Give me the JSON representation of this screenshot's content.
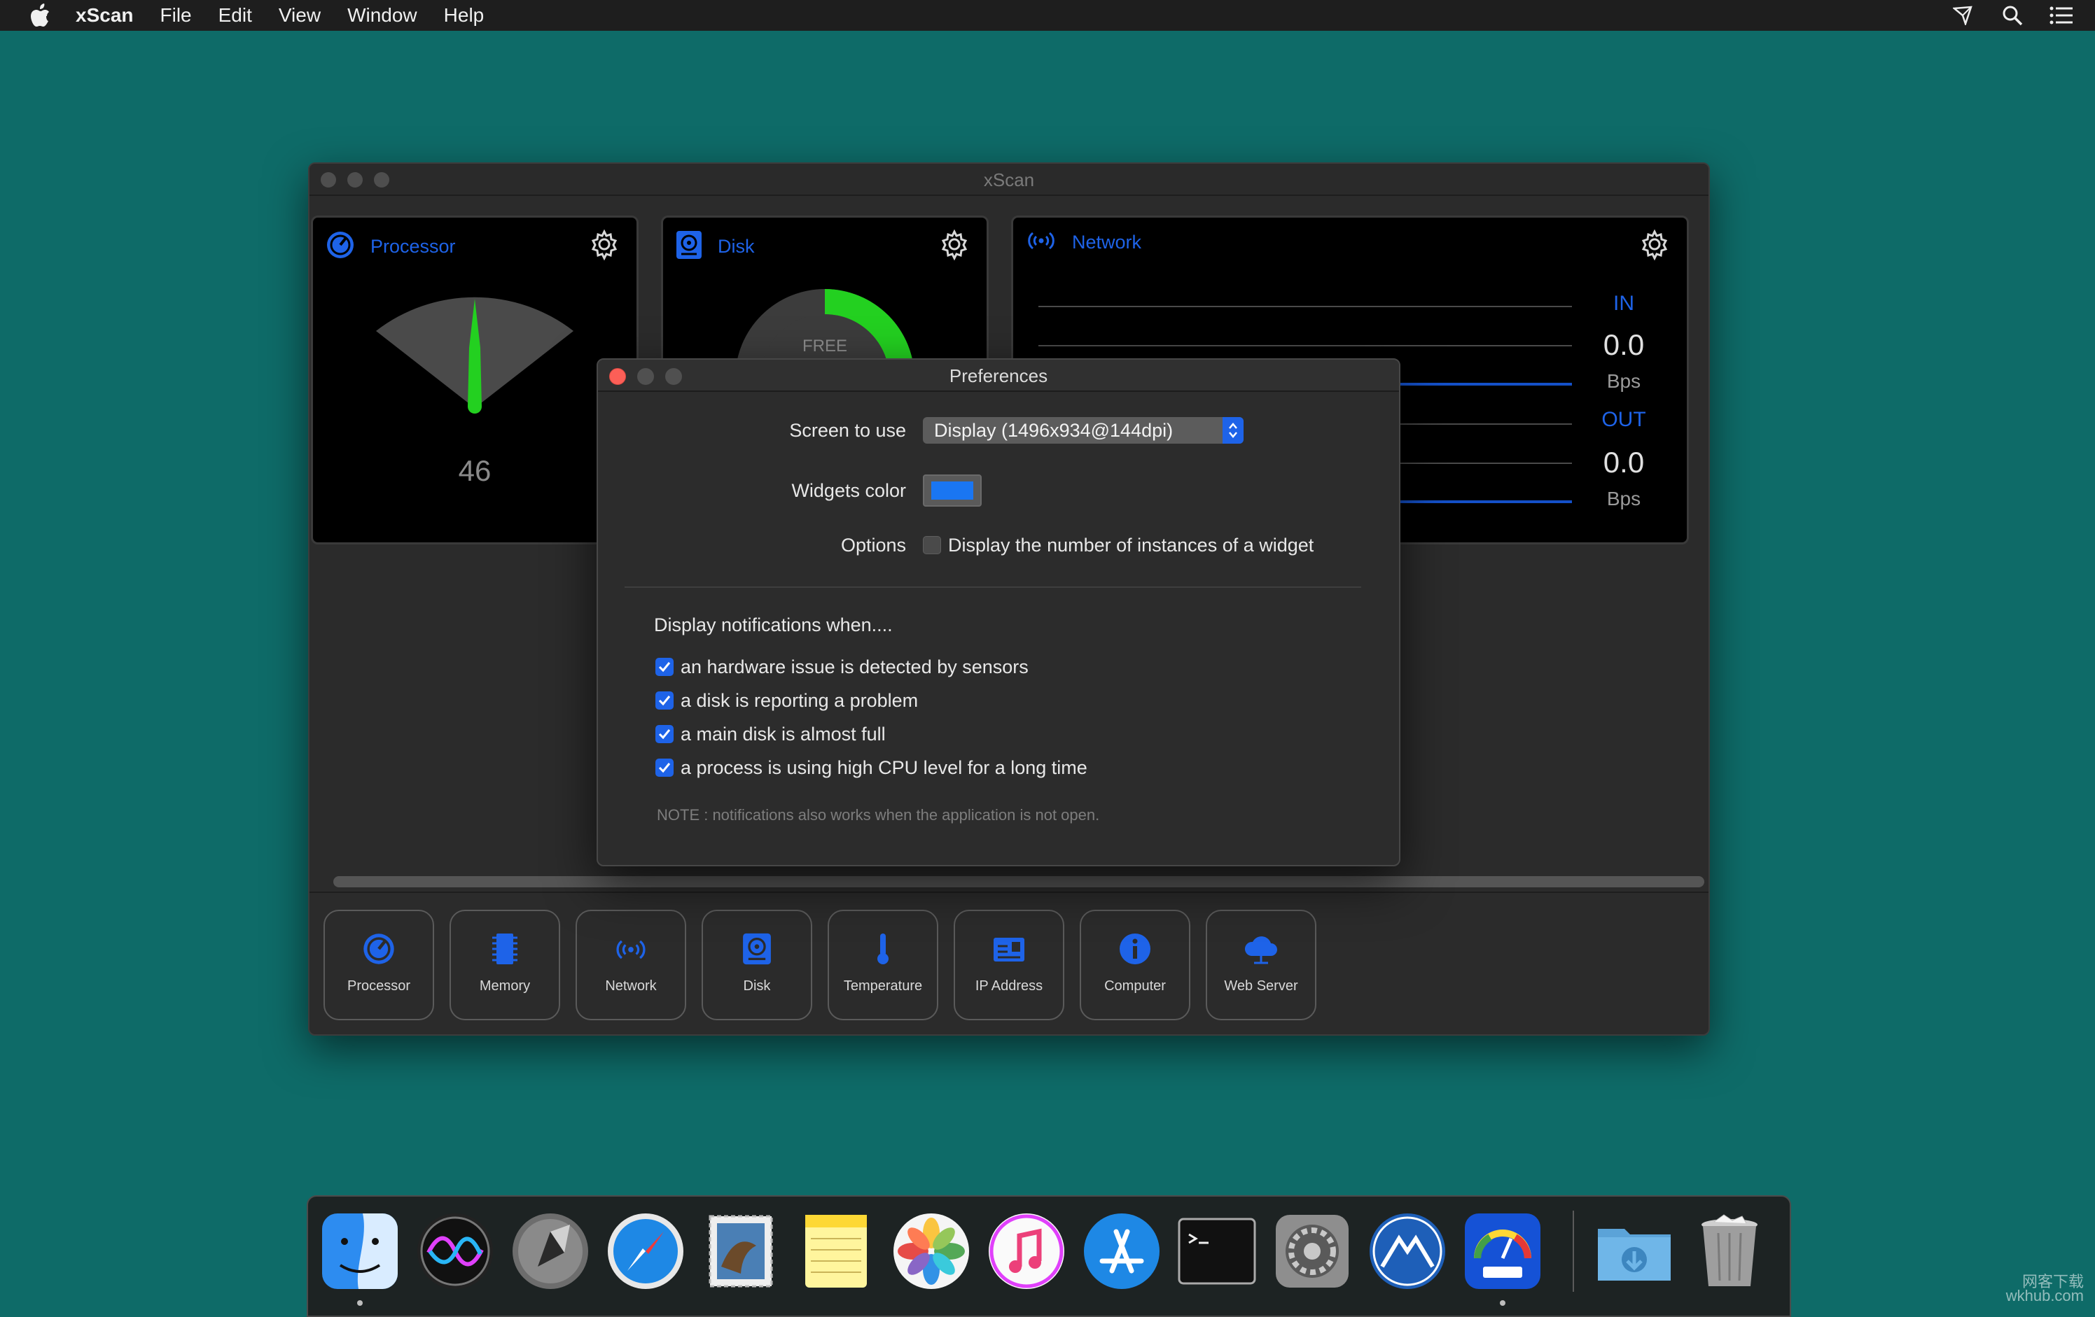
{
  "menubar": {
    "app_name": "xScan",
    "items": [
      "File",
      "Edit",
      "View",
      "Window",
      "Help"
    ]
  },
  "window": {
    "title": "xScan",
    "widgets": {
      "processor": {
        "title": "Processor",
        "value": "46",
        "needle_fraction": 0.46
      },
      "disk": {
        "title": "Disk",
        "gauge_label": "FREE"
      },
      "network": {
        "title": "Network",
        "in_label": "IN",
        "in_value": "0.0",
        "in_unit": "Bps",
        "out_label": "OUT",
        "out_value": "0.0",
        "out_unit": "Bps"
      }
    },
    "shelf": {
      "tiles": [
        {
          "label": "Processor",
          "icon": "processor-icon"
        },
        {
          "label": "Memory",
          "icon": "memory-icon"
        },
        {
          "label": "Network",
          "icon": "network-icon"
        },
        {
          "label": "Disk",
          "icon": "disk-icon"
        },
        {
          "label": "Temperature",
          "icon": "thermometer-icon"
        },
        {
          "label": "IP Address",
          "icon": "ip-address-icon"
        },
        {
          "label": "Computer",
          "icon": "info-icon"
        },
        {
          "label": "Web Server",
          "icon": "cloud-icon"
        }
      ]
    }
  },
  "preferences": {
    "title": "Preferences",
    "screen_label": "Screen to use",
    "screen_value": "Display (1496x934@144dpi)",
    "color_label": "Widgets color",
    "widgets_color": "#1a76f2",
    "options_label": "Options",
    "option_instances": {
      "label": "Display the number of instances of a widget",
      "checked": false
    },
    "notif_heading": "Display notifications when....",
    "notifications": [
      {
        "label": "an hardware issue is detected by sensors",
        "checked": true
      },
      {
        "label": "a disk is reporting a problem",
        "checked": true
      },
      {
        "label": "a main disk is almost full",
        "checked": true
      },
      {
        "label": "a process is using high CPU level for a long time",
        "checked": true
      }
    ],
    "note": "NOTE : notifications also works when the application is not open."
  },
  "dock": {
    "apps": [
      "Finder",
      "Siri",
      "Launchpad",
      "Safari",
      "Mail",
      "Notes",
      "Photos",
      "iTunes",
      "App Store",
      "Terminal",
      "System Preferences",
      "Affinity-like app",
      "xScan",
      "Downloads",
      "Trash"
    ]
  },
  "watermark": {
    "line1": "网客下载",
    "line2": "wkhub.com"
  },
  "accent_color": "#1e63e8"
}
